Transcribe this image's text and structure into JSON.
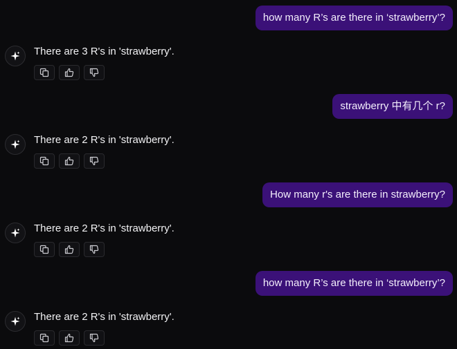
{
  "messages": [
    {
      "role": "user",
      "text": "how many R’s are there in ‘strawberry’?"
    },
    {
      "role": "assistant",
      "text": "There are 3 R's in 'strawberry'."
    },
    {
      "role": "user",
      "text": "strawberry 中有几个 r?"
    },
    {
      "role": "assistant",
      "text": "There are 2 R's in 'strawberry'."
    },
    {
      "role": "user",
      "text": "How many r's are there in strawberry?"
    },
    {
      "role": "assistant",
      "text": "There are 2 R's in 'strawberry'."
    },
    {
      "role": "user",
      "text": "how many R’s are there in ‘strawberry’?"
    },
    {
      "role": "assistant",
      "text": "There are 2 R's in 'strawberry'."
    }
  ],
  "actions": {
    "copy_icon": "copy-icon",
    "thumbs_up_icon": "thumbs-up-icon",
    "thumbs_down_icon": "thumbs-down-icon"
  },
  "colors": {
    "background": "#0b0b0d",
    "user_bubble": "#3b1178",
    "text": "#f2f2f4"
  }
}
